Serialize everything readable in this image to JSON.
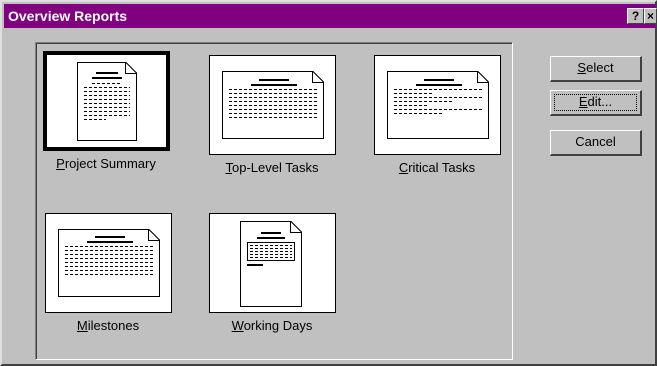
{
  "window": {
    "title": "Overview Reports",
    "help_label": "?",
    "close_label": "×",
    "titlebar_color": "#800080"
  },
  "reports": [
    {
      "label_pre": "",
      "label_key": "P",
      "label_post": "roject Summary",
      "selected": true
    },
    {
      "label_pre": "",
      "label_key": "T",
      "label_post": "op-Level Tasks",
      "selected": false
    },
    {
      "label_pre": "",
      "label_key": "C",
      "label_post": "ritical Tasks",
      "selected": false
    },
    {
      "label_pre": "",
      "label_key": "M",
      "label_post": "ilestones",
      "selected": false
    },
    {
      "label_pre": "",
      "label_key": "W",
      "label_post": "orking Days",
      "selected": false
    }
  ],
  "buttons": {
    "select": {
      "key": "S",
      "rest": "elect"
    },
    "edit": {
      "key": "E",
      "rest": "dit..."
    },
    "cancel": {
      "label": "Cancel"
    }
  }
}
